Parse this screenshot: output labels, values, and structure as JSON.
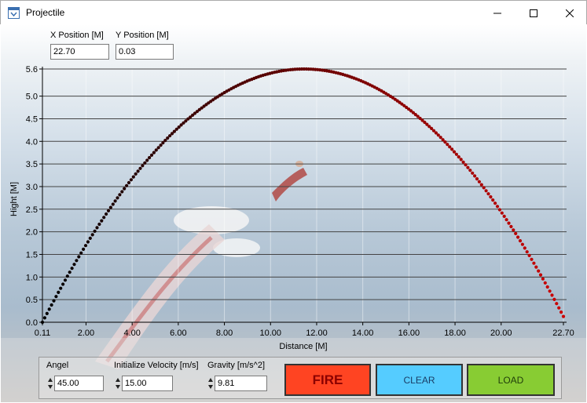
{
  "window": {
    "title": "Projectile",
    "icon": "app-window-icon",
    "controls": [
      "minimize-icon",
      "maximize-icon",
      "close-icon"
    ]
  },
  "position": {
    "x_label": "X Position [M]",
    "x_value": "22.70",
    "y_label": "Y Position [M]",
    "y_value": "0.03"
  },
  "controls": {
    "angle_label": "Angel",
    "angle_value": "45.00",
    "velocity_label": "Initialize Velocity [m/s]",
    "velocity_value": "15.00",
    "gravity_label": "Gravity [m/s^2]",
    "gravity_value": "9.81"
  },
  "buttons": {
    "fire": "FIRE",
    "clear": "CLEAR",
    "load": "LOAD"
  },
  "colors": {
    "fire": "#ff4422",
    "clear": "#55ccff",
    "load": "#88cc33",
    "trajectory_start": "#000000",
    "trajectory_end": "#cc0000"
  },
  "chart_data": {
    "type": "scatter",
    "xlabel": "Distance [M]",
    "ylabel": "Hight [M]",
    "xlim": [
      0.11,
      22.7
    ],
    "ylim": [
      0,
      5.6
    ],
    "x_ticks": [
      "0.11",
      "2.00",
      "4.00",
      "6.00",
      "8.00",
      "10.00",
      "12.00",
      "14.00",
      "16.00",
      "18.00",
      "20.00",
      "22.70"
    ],
    "y_ticks": [
      "0.0",
      "0.5",
      "1.0",
      "1.5",
      "2.0",
      "2.5",
      "3.0",
      "3.5",
      "4.0",
      "4.5",
      "5.0",
      "5.6"
    ],
    "series": [
      {
        "x_start": 0.11,
        "x_end": 22.7,
        "peak_x": 11.47,
        "peak_y": 5.6,
        "point_count": 230
      }
    ],
    "grid": true
  }
}
